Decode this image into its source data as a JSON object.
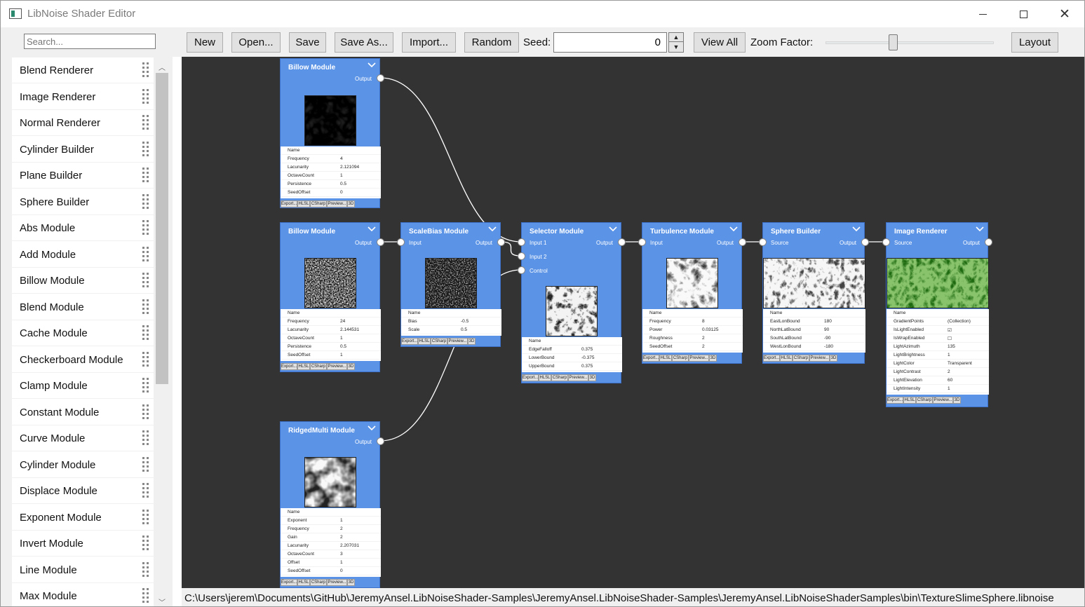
{
  "window": {
    "title": "LibNoise Shader Editor"
  },
  "search": {
    "placeholder": "Search..."
  },
  "sidebar": {
    "items": [
      "Blend Renderer",
      "Image Renderer",
      "Normal Renderer",
      "Cylinder Builder",
      "Plane Builder",
      "Sphere Builder",
      "Abs Module",
      "Add Module",
      "Billow Module",
      "Blend Module",
      "Cache Module",
      "Checkerboard Module",
      "Clamp Module",
      "Constant Module",
      "Curve Module",
      "Cylinder Module",
      "Displace Module",
      "Exponent Module",
      "Invert Module",
      "Line Module",
      "Max Module"
    ]
  },
  "toolbar": {
    "new_label": "New",
    "open_label": "Open...",
    "save_label": "Save",
    "save_as_label": "Save As...",
    "import_label": "Import...",
    "random_label": "Random",
    "seed_label": "Seed:",
    "seed_value": "0",
    "view_all_label": "View All",
    "zoom_label": "Zoom Factor:",
    "layout_label": "Layout",
    "zoom_level": 0.4
  },
  "node_buttons": [
    "Export...",
    "HLSL",
    "CSharp",
    "Preview...",
    "3D"
  ],
  "nodes": [
    {
      "title": "Billow Module",
      "outputs": [
        "Output"
      ],
      "inputs": [],
      "texture": "billow-coarse",
      "props": [
        [
          "Name",
          ""
        ],
        [
          "Frequency",
          "4"
        ],
        [
          "Lacunarity",
          "2.121094"
        ],
        [
          "OctaveCount",
          "1"
        ],
        [
          "Persistence",
          "0.5"
        ],
        [
          "SeedOffset",
          "0"
        ]
      ]
    },
    {
      "title": "Billow Module",
      "outputs": [
        "Output"
      ],
      "inputs": [],
      "texture": "billow-fine",
      "props": [
        [
          "Name",
          ""
        ],
        [
          "Frequency",
          "24"
        ],
        [
          "Lacunarity",
          "2.144531"
        ],
        [
          "OctaveCount",
          "1"
        ],
        [
          "Persistence",
          "0.5"
        ],
        [
          "SeedOffset",
          "1"
        ]
      ]
    },
    {
      "title": "ScaleBias Module",
      "outputs": [
        "Output"
      ],
      "inputs": [
        "Input"
      ],
      "texture": "scalebias",
      "props": [
        [
          "Name",
          ""
        ],
        [
          "Bias",
          "-0.5"
        ],
        [
          "Scale",
          "0.5"
        ]
      ]
    },
    {
      "title": "Selector Module",
      "outputs": [
        "Output"
      ],
      "inputs": [
        "Input 1",
        "Input 2",
        "Control"
      ],
      "texture": "selector",
      "props": [
        [
          "Name",
          ""
        ],
        [
          "EdgeFalloff",
          "0.375"
        ],
        [
          "LowerBound",
          "-0.375"
        ],
        [
          "UpperBound",
          "0.375"
        ]
      ]
    },
    {
      "title": "Turbulence Module",
      "outputs": [
        "Output"
      ],
      "inputs": [
        "Input"
      ],
      "texture": "turbulence",
      "props": [
        [
          "Name",
          ""
        ],
        [
          "Frequency",
          "8"
        ],
        [
          "Power",
          "0.03125"
        ],
        [
          "Roughness",
          "2"
        ],
        [
          "SeedOffset",
          "2"
        ]
      ]
    },
    {
      "title": "Sphere Builder",
      "outputs": [
        "Output"
      ],
      "inputs": [
        "Source"
      ],
      "texture": "sphere",
      "props": [
        [
          "Name",
          ""
        ],
        [
          "EastLonBound",
          "180"
        ],
        [
          "NorthLatBound",
          "90"
        ],
        [
          "SouthLatBound",
          "-90"
        ],
        [
          "WestLonBound",
          "-180"
        ]
      ]
    },
    {
      "title": "Image Renderer",
      "outputs": [
        "Output"
      ],
      "inputs": [
        "Source"
      ],
      "texture": "image",
      "props": [
        [
          "Name",
          ""
        ],
        [
          "GradientPoints",
          "(Collection)"
        ],
        [
          "IsLightEnabled",
          "☑"
        ],
        [
          "IsWrapEnabled",
          "☐"
        ],
        [
          "LightAzimuth",
          "135"
        ],
        [
          "LightBrightness",
          "1"
        ],
        [
          "LightColor",
          "Transparent"
        ],
        [
          "LightContrast",
          "2"
        ],
        [
          "LightElevation",
          "60"
        ],
        [
          "LightIntensity",
          "1"
        ]
      ]
    },
    {
      "title": "RidgedMulti Module",
      "outputs": [
        "Output"
      ],
      "inputs": [],
      "texture": "ridged",
      "props": [
        [
          "Name",
          ""
        ],
        [
          "Exponent",
          "1"
        ],
        [
          "Frequency",
          "2"
        ],
        [
          "Gain",
          "2"
        ],
        [
          "Lacunarity",
          "2.207031"
        ],
        [
          "OctaveCount",
          "3"
        ],
        [
          "Offset",
          "1"
        ],
        [
          "SeedOffset",
          "0"
        ]
      ]
    }
  ],
  "status": {
    "path": "C:\\Users\\jerem\\Documents\\GitHub\\JeremyAnsel.LibNoiseShader-Samples\\JeremyAnsel.LibNoiseShader-Samples\\JeremyAnsel.LibNoiseShaderSamples\\bin\\TextureSlimeSphere.libnoise"
  },
  "colors": {
    "node": "#5b93e6",
    "canvas": "#333333",
    "wire": "#ffffff"
  }
}
